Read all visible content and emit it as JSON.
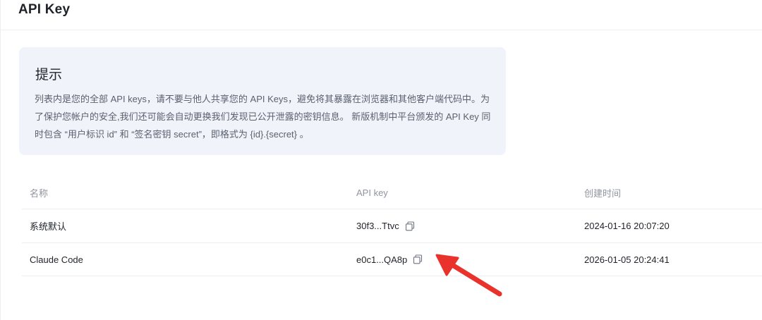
{
  "page": {
    "title": "API Key"
  },
  "notice": {
    "title": "提示",
    "body": "列表内是您的全部 API keys，请不要与他人共享您的 API Keys，避免将其暴露在浏览器和其他客户端代码中。为了保护您帐户的安全,我们还可能会自动更换我们发现已公开泄露的密钥信息。 新版机制中平台颁发的 API Key 同时包含 “用户标识 id” 和 “签名密钥 secret”，即格式为 {id}.{secret} 。"
  },
  "table": {
    "columns": {
      "name": "名称",
      "key": "API key",
      "created": "创建时间"
    },
    "rows": [
      {
        "name": "系统默认",
        "key": "30f3...Ttvc",
        "created": "2024-01-16 20:07:20"
      },
      {
        "name": "Claude Code",
        "key": "e0c1...QA8p",
        "created": "2026-01-05 20:24:41"
      }
    ]
  },
  "icons": {
    "copy": "copy-icon",
    "annotation_arrow": "red-arrow-icon"
  },
  "colors": {
    "notice_bg": "#f0f3fa",
    "arrow": "#e8322b"
  }
}
